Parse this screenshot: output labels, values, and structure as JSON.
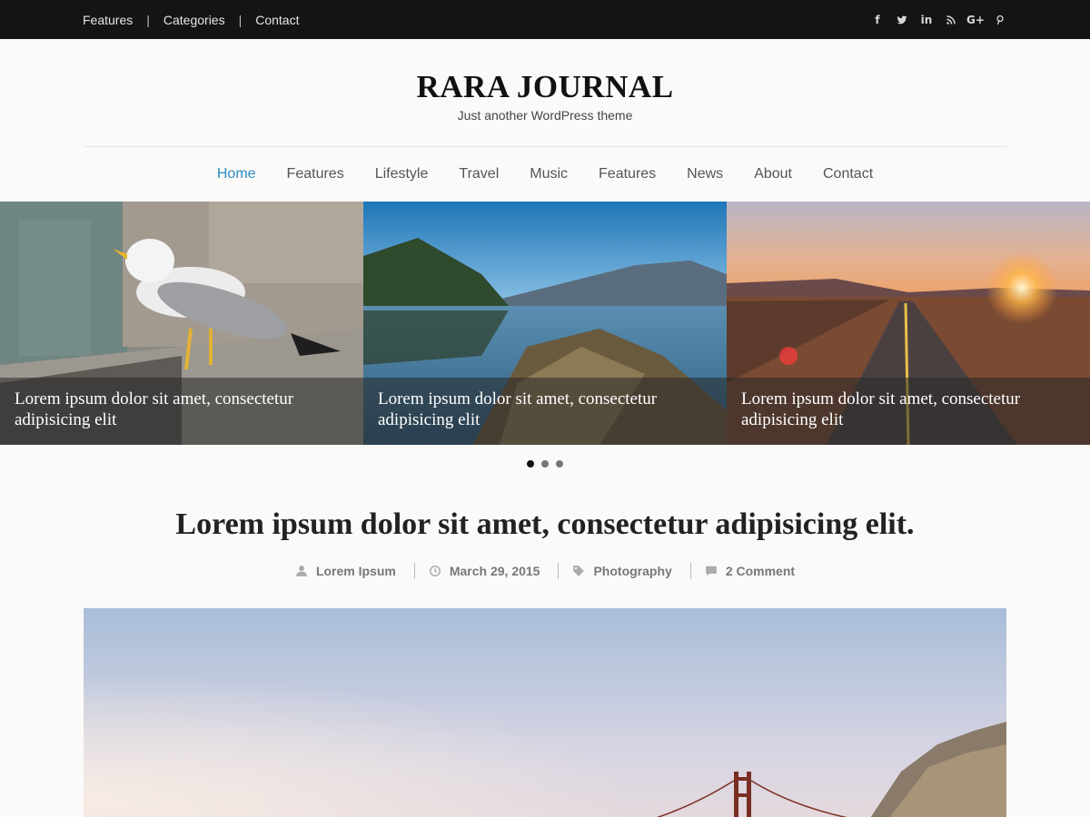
{
  "topbar": {
    "links": [
      "Features",
      "Categories",
      "Contact"
    ],
    "social_icons": [
      "facebook-icon",
      "twitter-icon",
      "linkedin-icon",
      "rss-icon",
      "google-plus-icon",
      "pinterest-icon"
    ],
    "social_glyphs": {
      "facebook": "f",
      "linkedin": "in",
      "google_plus": "G+"
    }
  },
  "branding": {
    "title": "RARA JOURNAL",
    "description": "Just another WordPress theme"
  },
  "nav": {
    "items": [
      "Home",
      "Features",
      "Lifestyle",
      "Travel",
      "Music",
      "Features",
      "News",
      "About",
      "Contact"
    ],
    "active_index": 0,
    "active_color": "#2b8dc1"
  },
  "slider": {
    "slides": [
      {
        "caption": "Lorem ipsum dolor sit amet, consectetur adipisicing elit",
        "image": "seagull"
      },
      {
        "caption": "Lorem ipsum dolor sit amet, consectetur adipisicing elit",
        "image": "mountain-lake"
      },
      {
        "caption": "Lorem ipsum dolor sit amet, consectetur adipisicing elit",
        "image": "sunset-road"
      }
    ],
    "active_dot": 0,
    "dot_count": 3
  },
  "post": {
    "title": "Lorem ipsum dolor sit amet, consectetur adipisicing elit.",
    "author": "Lorem Ipsum",
    "date": "March 29, 2015",
    "category": "Photography",
    "comments": "2 Comment",
    "image": "golden-gate-bridge"
  }
}
